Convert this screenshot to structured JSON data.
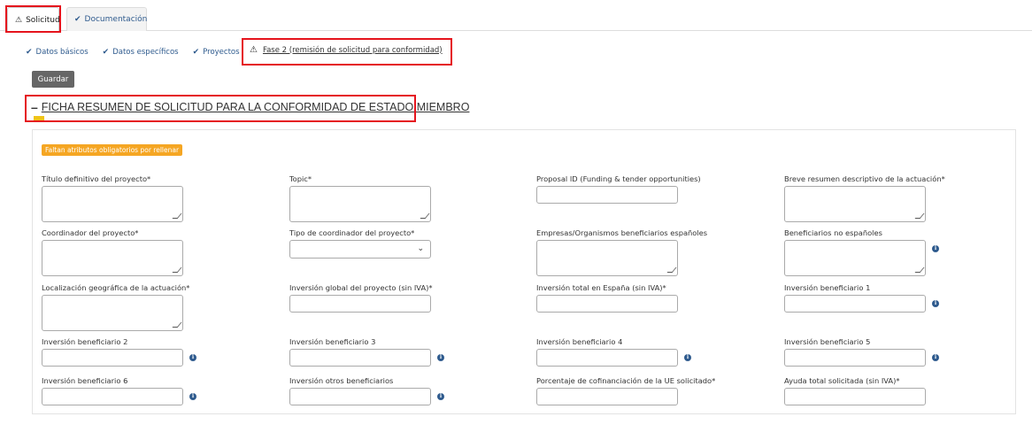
{
  "tabs": [
    {
      "label": "Solicitud",
      "icon": "warning-icon"
    },
    {
      "label": "Documentación",
      "icon": "check-icon"
    }
  ],
  "subtabs": [
    {
      "label": "Datos básicos",
      "icon": "check-icon"
    },
    {
      "label": "Datos específicos",
      "icon": "check-icon"
    },
    {
      "label": "Proyectos",
      "icon": "check-icon"
    }
  ],
  "active_subtab": {
    "label": "Fase 2 (remisión de solicitud para conformidad)",
    "icon": "warning-icon"
  },
  "toolbar": {
    "save_label": "Guardar"
  },
  "section": {
    "title": "FICHA RESUMEN DE SOLICITUD PARA LA CONFORMIDAD DE ESTADO MIEMBRO",
    "badge": "Faltan atributos obligatorios por rellenar"
  },
  "fields": {
    "titulo": "Título definitivo del proyecto*",
    "topic": "Topic*",
    "proposal_id": "Proposal ID (Funding & tender opportunities)",
    "resumen": "Breve resumen descriptivo de la actuación*",
    "coordinador": "Coordinador del proyecto*",
    "tipo_coordinador": "Tipo de coordinador del proyecto*",
    "empresas": "Empresas/Organismos beneficiarios españoles",
    "no_espanoles": "Beneficiarios no españoles",
    "localizacion": "Localización geográfica de la actuación*",
    "inversion_global": "Inversión global del proyecto (sin IVA)*",
    "inversion_espana": "Inversión total en España (sin IVA)*",
    "inv_b1": "Inversión beneficiario 1",
    "inv_b2": "Inversión beneficiario 2",
    "inv_b3": "Inversión beneficiario 3",
    "inv_b4": "Inversión beneficiario 4",
    "inv_b5": "Inversión beneficiario 5",
    "inv_b6": "Inversión beneficiario 6",
    "inv_otros": "Inversión otros beneficiarios",
    "cofinanciacion": "Porcentaje de cofinanciación de la UE solicitado*",
    "ayuda_total": "Ayuda total solicitada (sin IVA)*"
  },
  "colors": {
    "highlight": "#e5141d",
    "badge": "#f5a623",
    "accent": "#2f5b8e",
    "title_mark": "#f0c419"
  }
}
